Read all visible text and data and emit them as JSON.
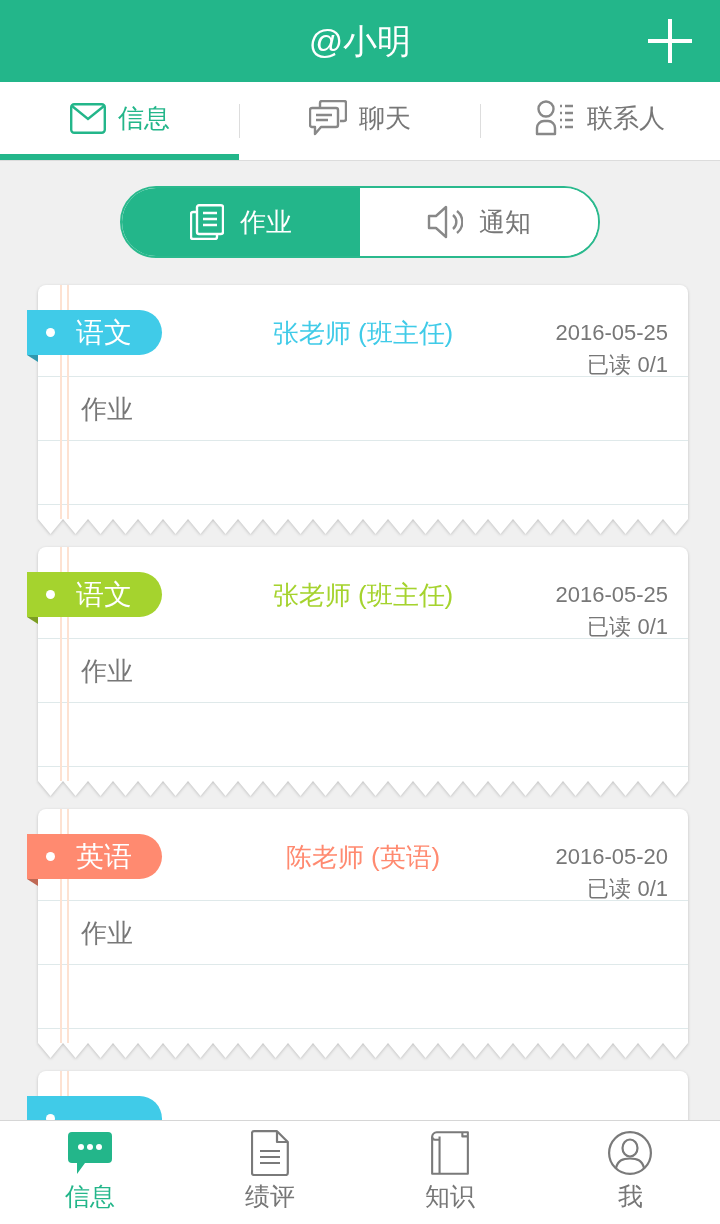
{
  "header": {
    "title": "@小明"
  },
  "tabs": [
    {
      "label": "信息",
      "selected": true
    },
    {
      "label": "聊天",
      "selected": false
    },
    {
      "label": "联系人",
      "selected": false
    }
  ],
  "segments": [
    {
      "label": "作业",
      "selected": true
    },
    {
      "label": "通知",
      "selected": false
    }
  ],
  "cards": [
    {
      "subject": "语文",
      "color": "#40cbe8",
      "teacher": "张老师 (班主任)",
      "date": "2016-05-25",
      "read": "已读 0/1",
      "body": "作业"
    },
    {
      "subject": "语文",
      "color": "#a5d32e",
      "teacher": "张老师 (班主任)",
      "date": "2016-05-25",
      "read": "已读 0/1",
      "body": "作业"
    },
    {
      "subject": "英语",
      "color": "#ff8a70",
      "teacher": "陈老师 (英语)",
      "date": "2016-05-20",
      "read": "已读 0/1",
      "body": "作业"
    },
    {
      "color": "#40cbe8"
    }
  ],
  "bottom_nav": [
    {
      "label": "信息",
      "selected": true
    },
    {
      "label": "绩评",
      "selected": false
    },
    {
      "label": "知识",
      "selected": false
    },
    {
      "label": "我",
      "selected": false
    }
  ]
}
